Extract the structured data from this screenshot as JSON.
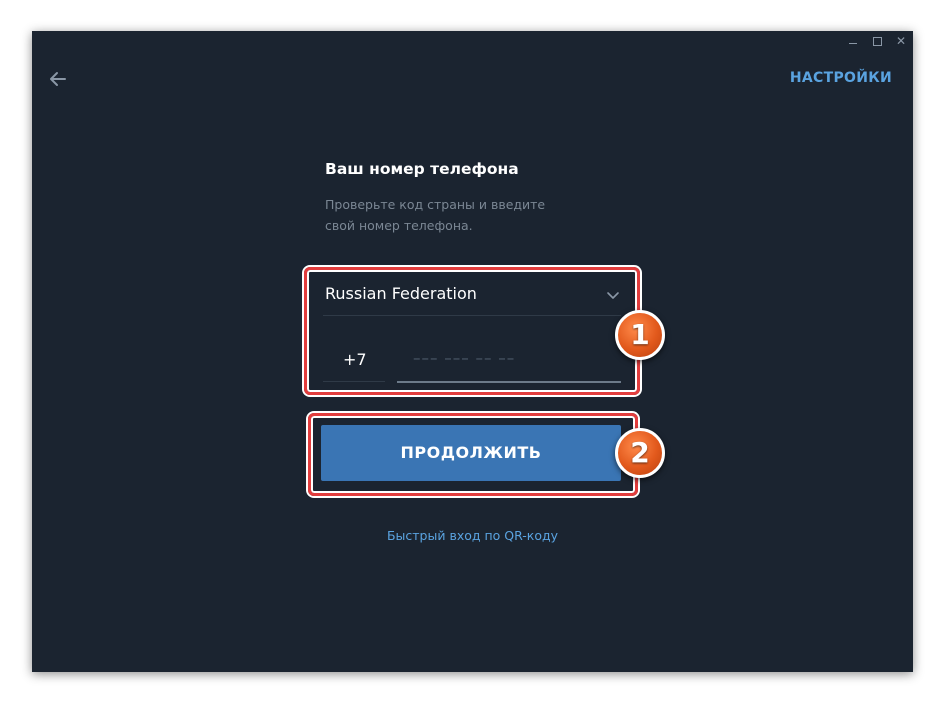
{
  "window_controls": {
    "minimize": "",
    "maximize": "",
    "close": "✕"
  },
  "header": {
    "settings_label": "НАСТРОЙКИ"
  },
  "form": {
    "title": "Ваш номер телефона",
    "subtitle": "Проверьте код страны и введите свой номер телефона.",
    "country": "Russian Federation",
    "country_code": "+7",
    "phone_placeholder": "––– ––– –– ––",
    "continue_label": "ПРОДОЛЖИТЬ",
    "qr_link_label": "Быстрый вход по QR-коду"
  },
  "annotations": {
    "badge_1": "1",
    "badge_2": "2"
  },
  "colors": {
    "background": "#1b2430",
    "accent": "#5aa3e0",
    "button": "#3a75b4",
    "highlight": "#e23d3d",
    "badge": "#e2591c"
  }
}
